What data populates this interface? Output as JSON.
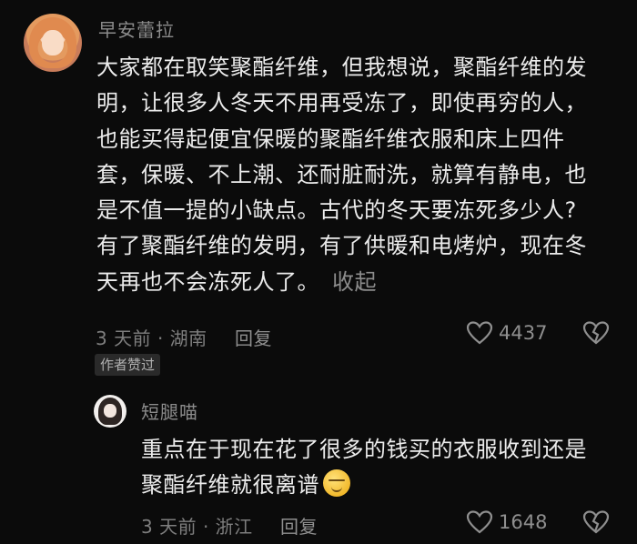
{
  "comments": [
    {
      "username": "早安蕾拉",
      "lines": [
        "大家都在取笑聚酯纤维，但我想说，聚酯纤维的发",
        "明，让很多人冬天不用再受冻了，即使再穷的人，",
        "也能买得起便宜保暖的聚酯纤维衣服和床上四件",
        "套，保暖、不上潮、还耐脏耐洗，就算有静电，也",
        "是不值一提的小缺点。古代的冬天要冻死多少人?",
        "有了聚酯纤维的发明，有了供暖和电烤炉，现在冬",
        "天再也不会冻死人了。"
      ],
      "collapse_label": "收起",
      "time_location": "3 天前 · 湖南",
      "reply_label": "回复",
      "likes": "4437",
      "badge": "作者赞过"
    },
    {
      "username": "短腿喵",
      "lines": [
        "重点在于现在花了很多的钱买的衣服收到还是",
        "聚酯纤维就很离谱"
      ],
      "time_location": "3 天前 · 浙江",
      "reply_label": "回复",
      "likes": "1648"
    }
  ],
  "icons": {
    "like": "heart-outline-icon",
    "dislike": "broken-heart-icon",
    "emoji": "awkward-face-emoji"
  }
}
